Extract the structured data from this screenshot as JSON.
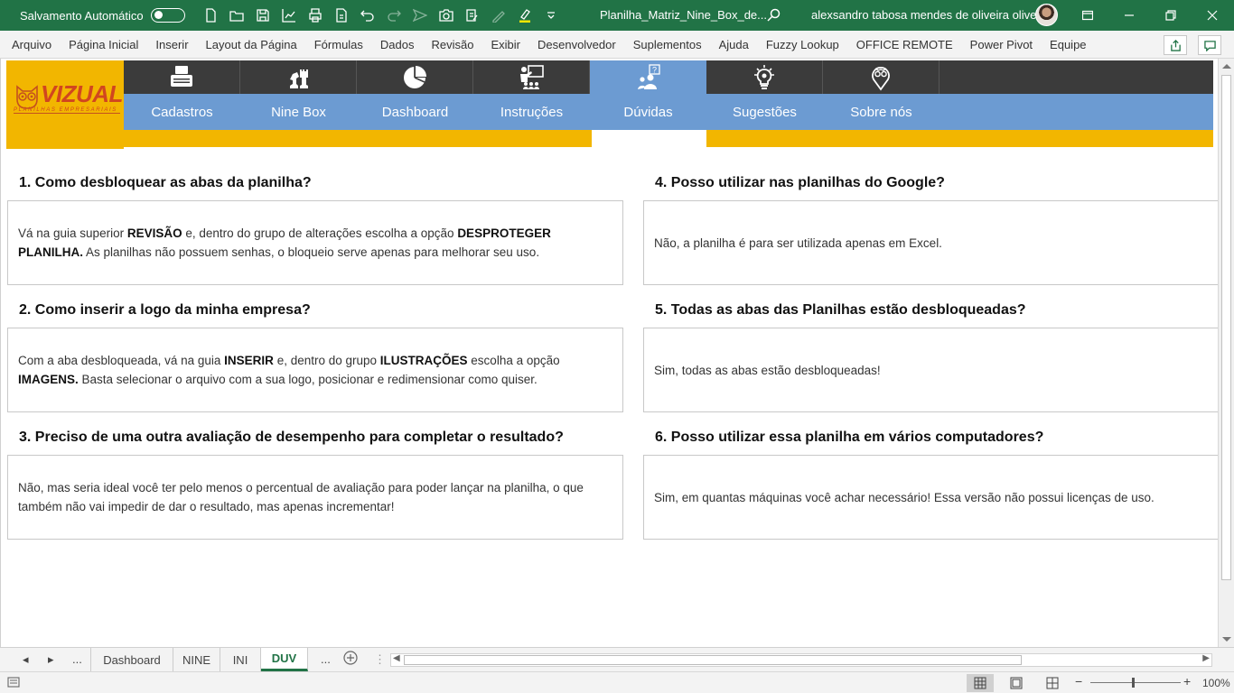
{
  "titlebar": {
    "autosave_label": "Salvamento Automático",
    "document_title": "Planilha_Matriz_Nine_Box_de...",
    "user_name": "alexsandro tabosa mendes de oliveira oliveira",
    "background": "#217346"
  },
  "menu": {
    "items": [
      "Arquivo",
      "Página Inicial",
      "Inserir",
      "Layout da Página",
      "Fórmulas",
      "Dados",
      "Revisão",
      "Exibir",
      "Desenvolvedor",
      "Suplementos",
      "Ajuda",
      "Fuzzy Lookup",
      "OFFICE REMOTE",
      "Power Pivot",
      "Equipe"
    ]
  },
  "logo": {
    "text": "VIZUAL",
    "subtitle": "PLANILHAS EMPRESARIAIS"
  },
  "nav": {
    "items": [
      {
        "label": "Cadastros",
        "icon": "typewriter-icon"
      },
      {
        "label": "Nine Box",
        "icon": "chess-icon"
      },
      {
        "label": "Dashboard",
        "icon": "pie-chart-icon"
      },
      {
        "label": "Instruções",
        "icon": "teacher-board-icon"
      },
      {
        "label": "Dúvidas",
        "icon": "question-people-icon"
      },
      {
        "label": "Sugestões",
        "icon": "lightbulb-icon"
      },
      {
        "label": "Sobre nós",
        "icon": "owl-pin-icon"
      }
    ],
    "active": "Dúvidas",
    "colors": {
      "dark": "#3b3b3b",
      "blue": "#6c9bd2",
      "gold": "#f2b600"
    }
  },
  "faq": [
    {
      "question": "1. Como desbloquear as abas da planilha?",
      "answer_parts": [
        {
          "t": "Vá na guia superior ",
          "b": false
        },
        {
          "t": "REVISÃO",
          "b": true
        },
        {
          "t": " e, dentro do grupo de alterações escolha a opção ",
          "b": false
        },
        {
          "t": "DESPROTEGER PLANILHA.",
          "b": true
        },
        {
          "t": " As planilhas não possuem senhas, o bloqueio serve apenas para melhorar seu uso.",
          "b": false
        }
      ]
    },
    {
      "question": "2. Como inserir a logo da minha empresa?",
      "answer_parts": [
        {
          "t": "Com a aba desbloqueada, vá na guia ",
          "b": false
        },
        {
          "t": "INSERIR",
          "b": true
        },
        {
          "t": " e, dentro do grupo ",
          "b": false
        },
        {
          "t": "ILUSTRAÇÕES",
          "b": true
        },
        {
          "t": " escolha a opção ",
          "b": false
        },
        {
          "t": "IMAGENS.",
          "b": true
        },
        {
          "t": " Basta selecionar o arquivo com a sua logo, posicionar e redimensionar como quiser.",
          "b": false
        }
      ]
    },
    {
      "question": "3. Preciso de uma outra avaliação de desempenho para completar o resultado?",
      "answer_parts": [
        {
          "t": "Não, mas seria ideal você ter pelo menos o percentual de avaliação para poder lançar na planilha, o que também não vai impedir de dar o resultado, mas apenas incrementar!",
          "b": false
        }
      ]
    },
    {
      "question": "4. Posso utilizar nas planilhas do Google?",
      "answer_parts": [
        {
          "t": "Não, a planilha é para ser utilizada apenas em Excel.",
          "b": false
        }
      ]
    },
    {
      "question": "5. Todas as abas das Planilhas estão desbloqueadas?",
      "answer_parts": [
        {
          "t": "Sim, todas as abas estão desbloqueadas!",
          "b": false
        }
      ]
    },
    {
      "question": "6. Posso utilizar essa planilha em vários computadores?",
      "answer_parts": [
        {
          "t": "Sim, em quantas máquinas você achar necessário! Essa versão não possui licenças de uso.",
          "b": false
        }
      ]
    }
  ],
  "sheet_tabs": {
    "ellipsis": "...",
    "items": [
      "Dashboard",
      "NINE",
      "INI",
      "DUV"
    ],
    "active": "DUV"
  },
  "status": {
    "zoom": "100%"
  }
}
